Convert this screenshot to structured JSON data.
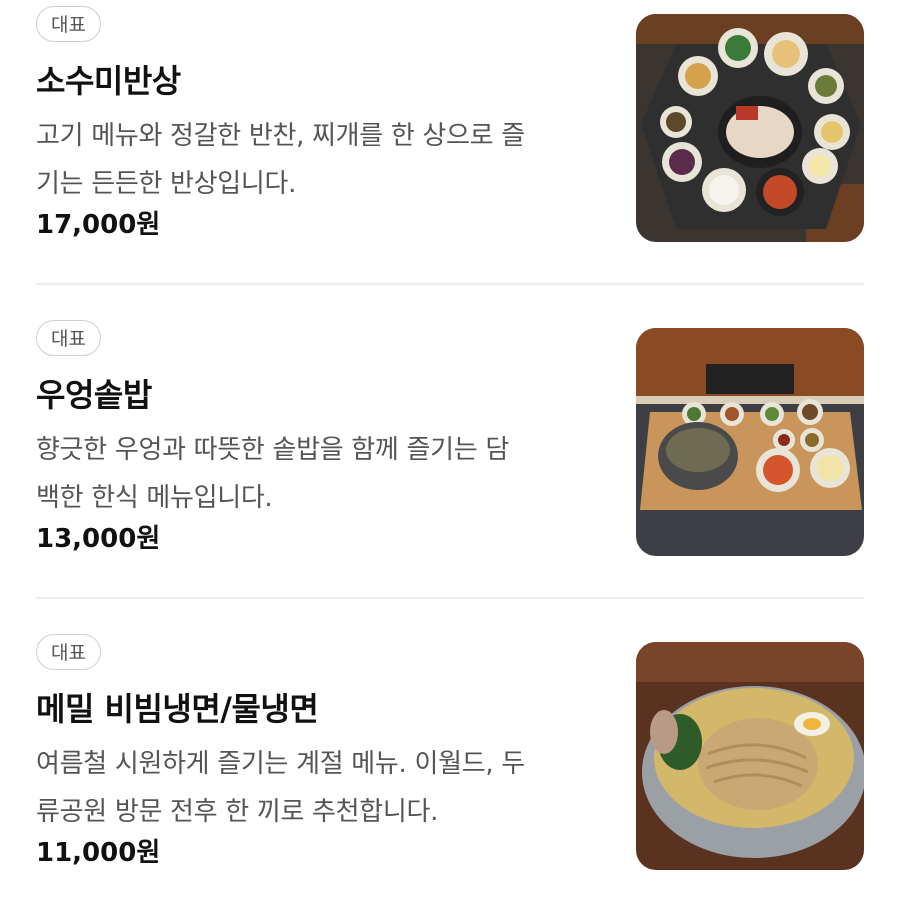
{
  "menu": {
    "items": [
      {
        "badge": "대표",
        "name": "소수미반상",
        "description_lines": [
          "고기 메뉴와 정갈한 반찬, 찌개를 한 상으로 즐",
          "기는 든든한 반상입니다."
        ],
        "price": "17,000원",
        "image": "korean-set-meal-photo"
      },
      {
        "badge": "대표",
        "name": "우엉솥밥",
        "description_lines": [
          "향긋한 우엉과 따뜻한 솥밥을 함께 즐기는 담",
          "백한 한식 메뉴입니다."
        ],
        "price": "13,000원",
        "image": "burdock-pot-rice-photo"
      },
      {
        "badge": "대표",
        "name": "메밀 비빔냉면/물냉면",
        "description_lines": [
          "여름철 시원하게 즐기는 계절 메뉴. 이월드, 두",
          "류공원 방문 전후 한 끼로 추천합니다."
        ],
        "price": "11,000원",
        "image": "buckwheat-cold-noodle-photo"
      }
    ]
  },
  "colors": {
    "text_primary": "#111111",
    "text_secondary": "#555555",
    "badge_border": "#cfcfcf",
    "divider": "#eeeeee"
  }
}
